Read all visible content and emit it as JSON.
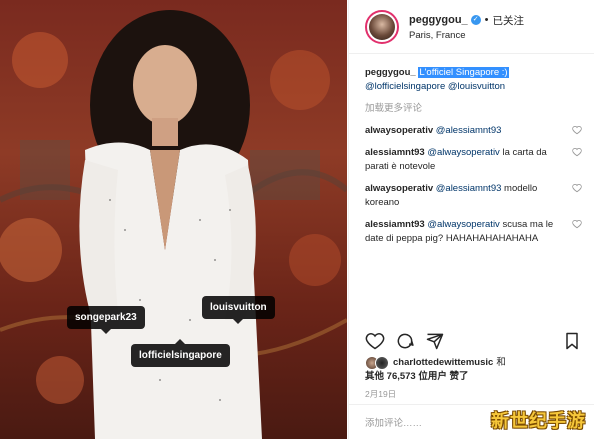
{
  "post": {
    "username": "peggygou_",
    "follow_label": "已关注",
    "location": "Paris, France"
  },
  "photo_tags": {
    "tag1": "songepark23",
    "tag2": "louisvuitton",
    "tag3": "lofficielsingapore"
  },
  "comments": [
    {
      "user": "peggygou_",
      "text_selected": "L'officiel Singapore :)",
      "text_rest": "@lofficielsingapore @louisvuitton"
    },
    {
      "user": "alwaysoperativ",
      "mention": "@alessiamnt93",
      "text": ""
    },
    {
      "user": "alessiamnt93",
      "mention": "@alwaysoperativ",
      "text": "la carta da parati è notevole"
    },
    {
      "user": "alwaysoperativ",
      "mention": "@alessiamnt93",
      "text": "modello koreano"
    },
    {
      "user": "alessiamnt93",
      "mention": "@alwaysoperativ",
      "text": "scusa ma le date di peppa pig? HAHAHAHAHAHAHA"
    }
  ],
  "load_more": "加载更多评论",
  "likes": {
    "user": "charlottedewittemusic",
    "and": "和",
    "others_prefix": "其他",
    "count": "76,573",
    "suffix": "位用户",
    "liked": "赞了"
  },
  "date": "2月19日",
  "add_comment_placeholder": "添加评论……",
  "watermark": "新世纪手游"
}
